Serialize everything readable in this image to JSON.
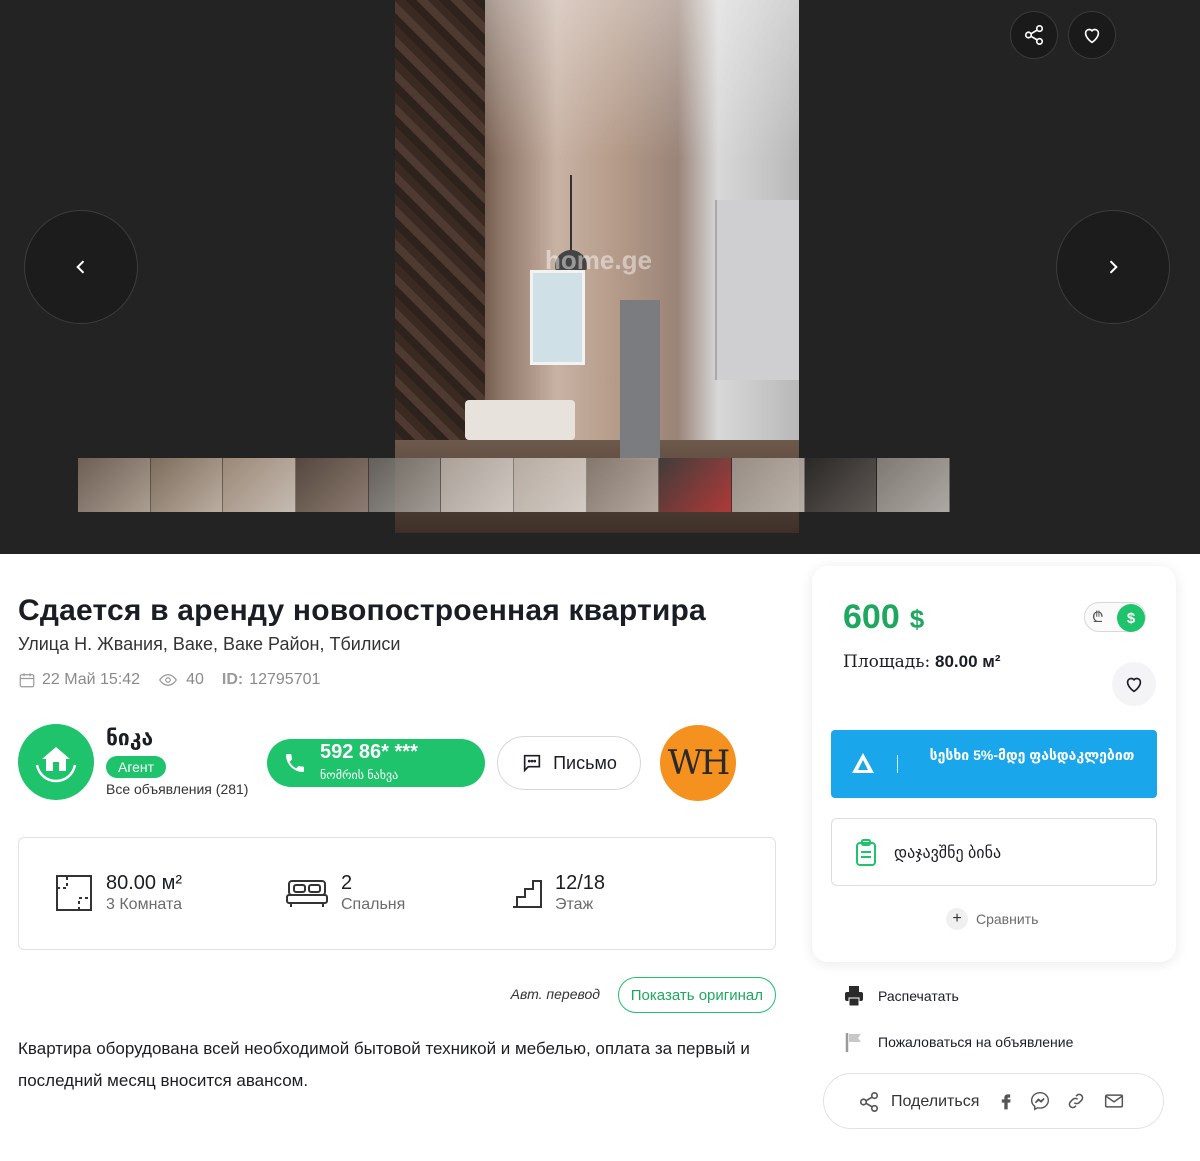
{
  "gallery": {
    "watermark": "home.ge",
    "share_icon": "share-icon",
    "favorite_icon": "heart-icon",
    "prev_icon": "chevron-left-icon",
    "next_icon": "chevron-right-icon",
    "thumbnail_count": 12
  },
  "listing": {
    "title": "Сдается в аренду новопостроенная квартира",
    "address": "Улица Н. Жвания, Ваке, Ваке Район, Тбилиси",
    "date": "22 Май 15:42",
    "views": "40",
    "id_label": "ID:",
    "id_value": "12795701"
  },
  "agent": {
    "name": "ნიკა",
    "badge": "Агент",
    "all_listings": "Все объявления (281)",
    "phone_number": "592 86* ***",
    "phone_sub": "ნომრის ნახვა",
    "mail_label": "Письмо",
    "agency_logo_text": "WH"
  },
  "features": {
    "area_value": "80.00 м²",
    "area_label": "3 Комната",
    "bedrooms_value": "2",
    "bedrooms_label": "Спальня",
    "floor_value": "12/18",
    "floor_label": "Этаж"
  },
  "translation": {
    "auto_label": "Авт. перевод",
    "show_original": "Показать оригинал"
  },
  "description": "Квартира оборудована всей необходимой бытовой техникой и мебелью, оплата за первый и последний месяц вносится авансом.",
  "price_card": {
    "price": "600",
    "currency": "$",
    "toggle_lari": "₾",
    "toggle_usd": "$",
    "area_label": "Площадь:",
    "area_value": "80.00 м²",
    "loan_text": "სესხი 5%-მდე ფასდაკლებით",
    "book_label": "დაჯავშნე ბინა",
    "compare_label": "Сравнить"
  },
  "side_links": {
    "print": "Распечатать",
    "report": "Пожаловаться на объявление",
    "share": "Поделиться"
  },
  "colors": {
    "accent_green": "#1ec36b",
    "price_green": "#1ea85f",
    "loan_blue": "#1aa6ea",
    "gallery_bg": "#232323",
    "agency_orange": "#f5911e"
  }
}
